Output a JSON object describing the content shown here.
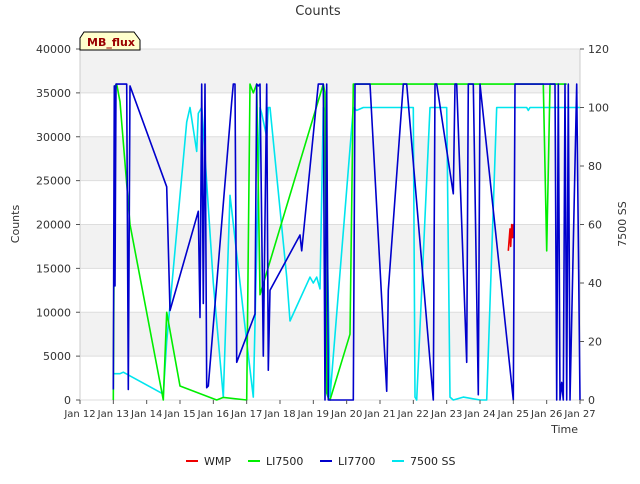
{
  "chart_data": {
    "type": "line",
    "title": "Counts",
    "badge": "MB_flux",
    "xlabel": "Time",
    "ylabel": "Counts",
    "y2label": "7500 SS",
    "grid": true,
    "legend_position": "bottom",
    "xlim": [
      0,
      15
    ],
    "ylim": [
      0,
      40000
    ],
    "y2lim": [
      0,
      120
    ],
    "x_ticks": [
      0,
      1,
      2,
      3,
      4,
      5,
      6,
      7,
      8,
      9,
      10,
      11,
      12,
      13,
      14,
      15
    ],
    "x_tick_labels": [
      "Jan 12",
      "Jan 13",
      "Jan 14",
      "Jan 15",
      "Jan 16",
      "Jan 17",
      "Jan 18",
      "Jan 19",
      "Jan 20",
      "Jan 21",
      "Jan 22",
      "Jan 23",
      "Jan 24",
      "Jan 25",
      "Jan 26",
      "Jan 27"
    ],
    "y_ticks": [
      0,
      5000,
      10000,
      15000,
      20000,
      25000,
      30000,
      35000,
      40000
    ],
    "y2_ticks": [
      0,
      20,
      40,
      60,
      80,
      100,
      120
    ],
    "x_unit_note": "x values are days after Jan 12",
    "series": [
      {
        "name": "WMP",
        "color": "#ee0000",
        "axis": "left",
        "x": [
          12.85,
          12.9,
          12.92,
          12.95,
          12.98,
          13.0,
          13.02
        ],
        "y": [
          17000,
          19500,
          17500,
          20000,
          18500,
          20000,
          19000
        ]
      },
      {
        "name": "LI7500",
        "color": "#00ee00",
        "axis": "left",
        "x": [
          1.0,
          1.05,
          1.1,
          1.2,
          1.5,
          2.5,
          2.6,
          3.0,
          4.1,
          4.3,
          5.0,
          5.1,
          5.2,
          5.3,
          5.4,
          7.3,
          7.35,
          7.4,
          7.45,
          7.5,
          8.1,
          8.2,
          8.3,
          8.5,
          13.9,
          14.0,
          14.1,
          14.2,
          14.3,
          14.4,
          14.5,
          14.6
        ],
        "y": [
          0,
          35800,
          36000,
          34000,
          20000,
          0,
          10000,
          1600,
          0,
          300,
          0,
          36000,
          35000,
          36000,
          12000,
          36000,
          35000,
          800,
          200,
          0,
          7500,
          36000,
          36000,
          36000,
          36000,
          17000,
          36000,
          36000,
          36000,
          36000,
          36000,
          36000
        ]
      },
      {
        "name": "LI7700",
        "color": "#0000cc",
        "axis": "left",
        "x": [
          1.0,
          1.03,
          1.05,
          1.08,
          1.1,
          1.13,
          1.15,
          1.4,
          1.45,
          1.5,
          2.6,
          2.7,
          3.55,
          3.6,
          3.65,
          3.7,
          3.75,
          3.8,
          3.85,
          4.55,
          4.6,
          4.65,
          4.7,
          5.25,
          5.3,
          5.35,
          5.4,
          5.5,
          5.6,
          5.65,
          5.7,
          6.6,
          6.65,
          7.15,
          7.25,
          7.3,
          7.35,
          7.4,
          7.45,
          7.7,
          8.2,
          8.25,
          8.3,
          8.7,
          9.2,
          9.25,
          9.7,
          9.8,
          10.6,
          10.65,
          10.7,
          11.2,
          11.25,
          11.3,
          11.6,
          11.65,
          11.7,
          11.8,
          11.95,
          12.0,
          13.0,
          13.05,
          13.1,
          13.15,
          13.3,
          13.35,
          13.4,
          13.45,
          13.5,
          14.2,
          14.25,
          14.3,
          14.35,
          14.4,
          14.45,
          14.5,
          14.55,
          14.6,
          14.65,
          14.7,
          14.9,
          15.0
        ],
        "y": [
          1200,
          35800,
          13000,
          36000,
          36000,
          36000,
          36000,
          36000,
          1200,
          35800,
          24300,
          10200,
          21500,
          9400,
          36000,
          11000,
          36000,
          1400,
          1600,
          34000,
          36000,
          36000,
          4300,
          9800,
          36000,
          35800,
          36000,
          5000,
          36000,
          3400,
          12500,
          18800,
          17000,
          36000,
          36000,
          36000,
          0,
          36000,
          0,
          0,
          0,
          36000,
          36000,
          36000,
          1000,
          12500,
          36000,
          36000,
          0,
          36000,
          36000,
          23500,
          36000,
          36000,
          4300,
          36000,
          36000,
          36000,
          600,
          36000,
          0,
          36000,
          36000,
          36000,
          36000,
          36000,
          36000,
          36000,
          36000,
          36000,
          36000,
          0,
          36000,
          0,
          2000,
          0,
          36000,
          0,
          36000,
          0,
          36000,
          0
        ]
      },
      {
        "name": "7500 SS",
        "color": "#00e5ee",
        "axis": "right",
        "x": [
          1.0,
          1.2,
          1.3,
          2.5,
          2.6,
          3.2,
          3.3,
          3.5,
          3.55,
          3.65,
          3.7,
          4.0,
          4.3,
          4.5,
          4.55,
          5.0,
          5.2,
          5.4,
          5.45,
          5.6,
          5.65,
          5.7,
          6.2,
          6.3,
          6.9,
          7.0,
          7.1,
          7.2,
          7.3,
          7.35,
          7.5,
          8.2,
          8.3,
          8.5,
          9.3,
          9.5,
          9.9,
          10.0,
          10.05,
          10.1,
          10.5,
          10.7,
          11.0,
          11.1,
          11.2,
          11.5,
          12.0,
          12.1,
          12.2,
          12.5,
          13.1,
          13.2,
          13.3,
          13.35,
          13.4,
          13.45,
          13.5,
          13.55,
          13.6,
          13.65,
          13.7,
          13.75,
          13.8,
          13.85,
          13.9,
          14.0,
          14.1,
          14.15,
          14.2,
          14.25,
          14.3,
          14.35,
          14.4,
          14.45,
          14.5,
          14.55,
          14.6,
          14.65,
          14.7,
          14.75,
          14.8,
          14.85,
          14.9,
          14.95,
          15.0
        ],
        "y": [
          9,
          9,
          9.5,
          2,
          20,
          95,
          100,
          85,
          98,
          100,
          92,
          40,
          1,
          70,
          65,
          20,
          1,
          100,
          98,
          90,
          100,
          100,
          42,
          27,
          42,
          40,
          42,
          38,
          100,
          99,
          1,
          100,
          99,
          100,
          100,
          100,
          100,
          100,
          1,
          0,
          100,
          100,
          100,
          1,
          0,
          1,
          0,
          0,
          0,
          100,
          100,
          100,
          100,
          100,
          100,
          99,
          100,
          100,
          100,
          100,
          100,
          100,
          100,
          100,
          100,
          100,
          100,
          100,
          100,
          100,
          100,
          100,
          100,
          100,
          100,
          100,
          100,
          100,
          100,
          100,
          100,
          100,
          100,
          100,
          100
        ]
      }
    ]
  }
}
